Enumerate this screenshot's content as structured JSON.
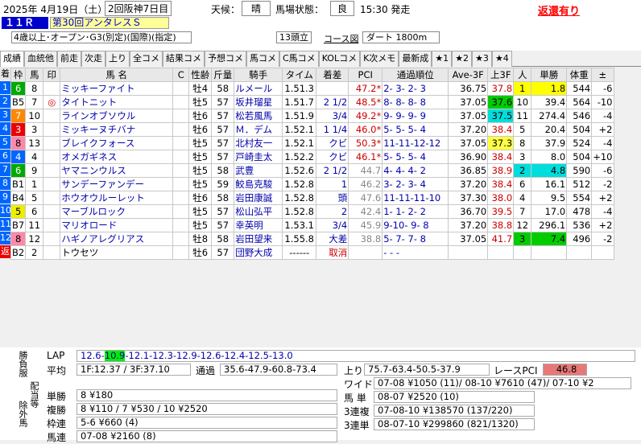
{
  "header": {
    "date": "2025年 4月19日（土）",
    "meeting": "2回阪神7日目",
    "weather_label": "天候：",
    "weather": "晴",
    "track_label": "馬場状態：",
    "track": "良",
    "start": "15:30 発走",
    "refund": "返還有り",
    "race_no": "１１Ｒ",
    "race_name": "第30回アンタレスＳ",
    "conditions": "4歳以上･オープン･G3(別定)(国際)(指定)",
    "runners": "13頭立",
    "course_btn": "コース図",
    "distance": "ダート 1800m"
  },
  "tabs": [
    "成績",
    "血統他",
    "前走",
    "次走",
    "上り",
    "全コメ",
    "結果コメ",
    "予想コメ",
    "馬コメ",
    "C馬コメ",
    "KOLコメ",
    "K次メモ",
    "最新成",
    "★1",
    "★2",
    "★3",
    "★4"
  ],
  "columns": [
    "着",
    "枠",
    "馬",
    "印",
    "馬 名",
    "C",
    "性齢",
    "斤量",
    "騎手",
    "タイム",
    "着差",
    "PCI",
    "通過順位",
    "Ave-3F",
    "上3F",
    "人",
    "単勝",
    "体重",
    "±"
  ],
  "rows": [
    {
      "rank": "1",
      "waku": "6",
      "uma": "8",
      "mark": "",
      "name": "ミッキーファイト",
      "c": "",
      "sex": "牡4",
      "kin": "58",
      "jockey": "ルメール",
      "time": "1.51.3",
      "diff": "",
      "pci": "47.2",
      "pciStar": "*",
      "pass": "2- 3- 2- 3",
      "ave": "36.75",
      "f3": "37.8",
      "f3c": "",
      "pop": "1",
      "popc": "yl",
      "odds": "1.8",
      "oddc": "yl",
      "wt": "544",
      "pm": "-6"
    },
    {
      "rank": "2",
      "waku": "B5",
      "uma": "7",
      "mark": "◎",
      "name": "タイトニット",
      "c": "",
      "sex": "牡5",
      "kin": "57",
      "jockey": "坂井瑠星",
      "time": "1.51.7",
      "diff": "2 1/2",
      "pci": "48.5",
      "pciStar": "*",
      "pass": "8- 8- 8- 8",
      "ave": "37.05",
      "f3": "37.6",
      "f3c": "gr",
      "pop": "10",
      "popc": "",
      "odds": "39.4",
      "oddc": "",
      "wt": "564",
      "pm": "-10"
    },
    {
      "rank": "3",
      "waku": "7",
      "uma": "10",
      "mark": "",
      "name": "ラインオブソウル",
      "c": "",
      "sex": "牡6",
      "kin": "57",
      "jockey": "松若風馬",
      "time": "1.51.9",
      "diff": "3/4",
      "pci": "49.2",
      "pciStar": "*",
      "pass": "9- 9- 9- 9",
      "ave": "37.05",
      "f3": "37.5",
      "f3c": "cy",
      "pop": "11",
      "popc": "",
      "odds": "274.4",
      "oddc": "",
      "wt": "546",
      "pm": "-4"
    },
    {
      "rank": "4",
      "waku": "3",
      "uma": "3",
      "mark": "",
      "name": "ミッキーヌチバナ",
      "c": "",
      "sex": "牡6",
      "kin": "57",
      "jockey": "Ｍ．デム",
      "time": "1.52.1",
      "diff": "1 1/4",
      "pci": "46.0",
      "pciStar": "*",
      "pass": "5- 5- 5- 4",
      "ave": "37.20",
      "f3": "38.4",
      "f3c": "",
      "pop": "5",
      "popc": "",
      "odds": "20.4",
      "oddc": "",
      "wt": "504",
      "pm": "+2"
    },
    {
      "rank": "5",
      "waku": "8",
      "uma": "13",
      "mark": "",
      "name": "ブレイクフォース",
      "c": "",
      "sex": "牡5",
      "kin": "57",
      "jockey": "北村友一",
      "time": "1.52.1",
      "diff": "クビ",
      "pci": "50.3",
      "pciStar": "*",
      "pass": "11-11-12-12",
      "ave": "37.05",
      "f3": "37.3",
      "f3c": "yg",
      "pop": "8",
      "popc": "",
      "odds": "37.9",
      "oddc": "",
      "wt": "524",
      "pm": "-4"
    },
    {
      "rank": "6",
      "waku": "4",
      "uma": "4",
      "mark": "",
      "name": "オメガギネス",
      "c": "",
      "sex": "牡5",
      "kin": "57",
      "jockey": "戸崎圭太",
      "time": "1.52.2",
      "diff": "クビ",
      "pci": "46.1",
      "pciStar": "*",
      "pass": "5- 5- 5- 4",
      "ave": "36.90",
      "f3": "38.4",
      "f3c": "",
      "pop": "3",
      "popc": "",
      "odds": "8.0",
      "oddc": "",
      "wt": "504",
      "pm": "+10"
    },
    {
      "rank": "7",
      "waku": "6",
      "uma": "9",
      "mark": "",
      "name": "ヤマニンウルス",
      "c": "",
      "sex": "牡5",
      "kin": "58",
      "jockey": "武豊",
      "time": "1.52.6",
      "diff": "2 1/2",
      "pci": "44.7",
      "pciStar": "",
      "pass": "4- 4- 4- 2",
      "ave": "36.85",
      "f3": "38.9",
      "f3c": "",
      "pop": "2",
      "popc": "cy",
      "odds": "4.8",
      "oddc": "cy",
      "wt": "590",
      "pm": "-6"
    },
    {
      "rank": "8",
      "waku": "B1",
      "uma": "1",
      "mark": "",
      "name": "サンデーファンデー",
      "c": "",
      "sex": "牡5",
      "kin": "59",
      "jockey": "鮫島克駿",
      "time": "1.52.8",
      "diff": "1",
      "pci": "46.2",
      "pciStar": "",
      "pass": "3- 2- 3- 4",
      "ave": "37.20",
      "f3": "38.4",
      "f3c": "",
      "pop": "6",
      "popc": "",
      "odds": "16.1",
      "oddc": "",
      "wt": "512",
      "pm": "-2"
    },
    {
      "rank": "9",
      "waku": "B4",
      "uma": "5",
      "mark": "",
      "name": "ホウオウルーレット",
      "c": "",
      "sex": "牡6",
      "kin": "58",
      "jockey": "岩田康誠",
      "time": "1.52.8",
      "diff": "頭",
      "pci": "47.6",
      "pciStar": "",
      "pass": "11-11-11-10",
      "ave": "37.30",
      "f3": "38.0",
      "f3c": "",
      "pop": "4",
      "popc": "",
      "odds": "9.5",
      "oddc": "",
      "wt": "554",
      "pm": "+2"
    },
    {
      "rank": "10",
      "waku": "5",
      "uma": "6",
      "mark": "",
      "name": "マーブルロック",
      "c": "",
      "sex": "牡5",
      "kin": "57",
      "jockey": "松山弘平",
      "time": "1.52.8",
      "diff": "2",
      "pci": "42.4",
      "pciStar": "",
      "pass": "1- 1- 2- 2",
      "ave": "36.70",
      "f3": "39.5",
      "f3c": "",
      "pop": "7",
      "popc": "",
      "odds": "17.0",
      "oddc": "",
      "wt": "478",
      "pm": "-4"
    },
    {
      "rank": "11",
      "waku": "B7",
      "uma": "11",
      "mark": "",
      "name": "マリオロード",
      "c": "",
      "sex": "牡5",
      "kin": "57",
      "jockey": "幸英明",
      "time": "1.53.1",
      "diff": "3/4",
      "pci": "45.9",
      "pciStar": "",
      "pass": "9-10- 9- 8",
      "ave": "37.20",
      "f3": "38.8",
      "f3c": "",
      "pop": "12",
      "popc": "",
      "odds": "296.1",
      "oddc": "",
      "wt": "536",
      "pm": "+2"
    },
    {
      "rank": "12",
      "waku": "8",
      "uma": "12",
      "mark": "",
      "name": "ハギノアレグリアス",
      "c": "",
      "sex": "牡8",
      "kin": "58",
      "jockey": "岩田望来",
      "time": "1.55.8",
      "diff": "大差",
      "pci": "38.8",
      "pciStar": "",
      "pass": "5- 7- 7- 8",
      "ave": "37.05",
      "f3": "41.7",
      "f3c": "",
      "pop": "3",
      "popc": "gr",
      "odds": "7.4",
      "oddc": "gr",
      "wt": "496",
      "pm": "-2"
    },
    {
      "rank": "返",
      "waku": "B2",
      "uma": "2",
      "mark": "",
      "name": "トウセツ",
      "c": "",
      "sex": "牡6",
      "kin": "57",
      "jockey": "団野大成",
      "time": "------",
      "diff": "取消",
      "pci": "",
      "pciStar": "",
      "pass": "-     -     -",
      "ave": "",
      "f3": "",
      "f3c": "",
      "pop": "",
      "popc": "",
      "odds": "",
      "oddc": "",
      "wt": "",
      "pm": ""
    }
  ],
  "lap": {
    "label": "LAP",
    "pre": "12.6-",
    "hi": "10.9",
    "post": "-12.1-12.3-12.9-12.6-12.4-12.5-13.0"
  },
  "avg": {
    "label": "平均",
    "value": "1F:12.37 / 3F:37.10",
    "kako_label": "通過",
    "kako": "35.6-47.9-60.8-73.4",
    "agari_label": "上り",
    "agari": "75.7-63.4-50.5-37.9",
    "pci_label": "レースPCI",
    "pci": "46.8"
  },
  "side": {
    "a": "勝負服",
    "b": "配当等",
    "c": "除外馬"
  },
  "pay": [
    {
      "label": "単勝",
      "value": "8 ¥180"
    },
    {
      "label": "複勝",
      "value": "8 ¥110 / 7 ¥530 / 10 ¥2520"
    },
    {
      "label": "枠連",
      "value": "5-6 ¥660 (4)"
    },
    {
      "label": "馬連",
      "value": "07-08 ¥2160 (8)"
    }
  ],
  "pay2": [
    {
      "label": "ワイド",
      "value": "07-08 ¥1050 (11)/ 08-10 ¥7610 (47)/ 07-10 ¥2"
    },
    {
      "label": "馬 単",
      "value": "08-07 ¥2520 (10)"
    },
    {
      "label": "3連複",
      "value": "07-08-10 ¥138570 (137/220)"
    },
    {
      "label": "3連単",
      "value": "08-07-10 ¥299860 (821/1320)"
    }
  ]
}
